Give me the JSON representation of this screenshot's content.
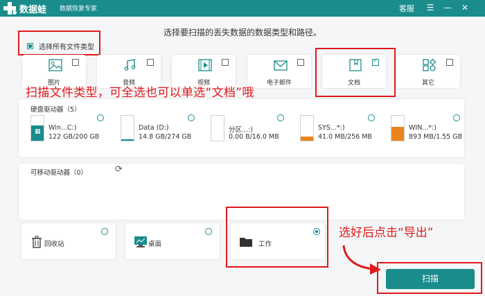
{
  "app": {
    "name": "数据蛙",
    "subtitle": "数据恢复专家"
  },
  "titlebar": {
    "service_label": "客服",
    "icons": [
      "menu-icon",
      "minimize-icon",
      "close-icon"
    ]
  },
  "instruction": "选择要扫描的丢失数据的数据类型和路径。",
  "select_all": {
    "label": "选择所有文件类型",
    "checked": true
  },
  "file_types": [
    {
      "label": "图片",
      "icon": "image-icon",
      "checked": false
    },
    {
      "label": "音频",
      "icon": "audio-icon",
      "checked": false
    },
    {
      "label": "视频",
      "icon": "video-icon",
      "checked": false
    },
    {
      "label": "电子邮件",
      "icon": "email-icon",
      "checked": false
    },
    {
      "label": "文档",
      "icon": "document-icon",
      "checked": true
    },
    {
      "label": "其它",
      "icon": "other-icon",
      "checked": false
    }
  ],
  "annotation_1": "扫描文件类型，可全选也可以单选“文档”哦",
  "hard_drives": {
    "title": "硬盘驱动器（5）",
    "items": [
      {
        "name": "Win...C:)",
        "size": "122 GB/200 GB",
        "fill": 0.61,
        "color": "#1a8c8b"
      },
      {
        "name": "Data (D:)",
        "size": "14.8 GB/274 GB",
        "fill": 0.05,
        "color": "#1a8c8b"
      },
      {
        "name": "分区...:)",
        "size": "0.00 B/16.0 MB",
        "fill": 0.0,
        "color": "#1a8c8b"
      },
      {
        "name": "SYS...*:)",
        "size": "41.0 MB/256 MB",
        "fill": 0.16,
        "color": "#e8861c"
      },
      {
        "name": "WIN...*:)",
        "size": "893 MB/1.55 GB",
        "fill": 0.56,
        "color": "#e8861c"
      }
    ]
  },
  "removable": {
    "title": "可移动驱动器（0）"
  },
  "locations": [
    {
      "label": "回收站",
      "icon": "recycle-bin-icon",
      "selected": false
    },
    {
      "label": "桌面",
      "icon": "desktop-icon",
      "selected": false
    },
    {
      "label": "工作",
      "icon": "folder-icon",
      "selected": true
    }
  ],
  "annotation_2": "选好后点击“导出”",
  "scan_button": "扫描",
  "colors": {
    "accent": "#1a8c8b",
    "annotation": "#e0191b",
    "warning": "#e8861c"
  }
}
